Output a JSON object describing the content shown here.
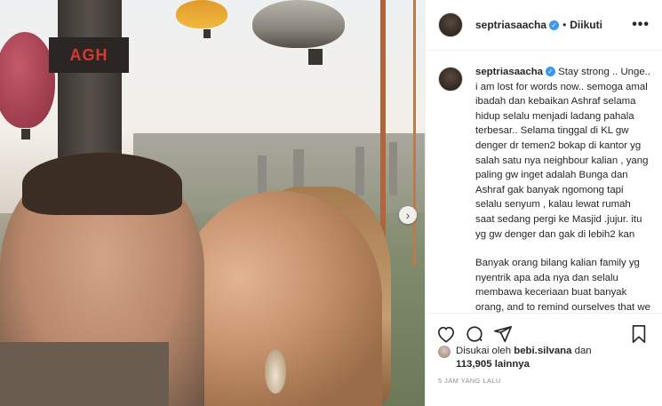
{
  "header": {
    "username": "septriasaacha",
    "follow_status": "Diikuti",
    "more_label": "•••"
  },
  "photo": {
    "sign_text": "AGH"
  },
  "caption": {
    "username": "septriasaacha",
    "paragraph1": "Stay strong .. Unge.. i am lost for words now.. semoga amal ibadah dan kebaikan Ashraf selama hidup selalu menjadi ladang pahala terbesar.. Selama tinggal di KL gw denger dr temen2 bokap di kantor yg salah satu nya neighbour kalian , yang paling gw inget adalah Bunga dan Ashraf gak banyak ngomong tapi selalu senyum , kalau lewat rumah saat sedang pergi ke Masjid .jujur. itu yg gw denger dan gak di lebih2 kan",
    "paragraph2": "Banyak orang bilang kalian family yg nyentrik apa ada nya dan selalu membawa keceriaan buat banyak orang, and to remind ourselves that we can always just be who we wanted to be.. just the way we are.. Makasi"
  },
  "likes": {
    "prefix": "Disukai oleh",
    "liker": "bebi.silvana",
    "joiner": "dan",
    "count": "113,905",
    "suffix": "lainnya"
  },
  "timestamp": "5 JAM YANG LALU",
  "icons": [
    "heart-icon",
    "comment-icon",
    "share-icon",
    "bookmark-icon",
    "verified-badge-icon",
    "next-arrow-icon"
  ]
}
